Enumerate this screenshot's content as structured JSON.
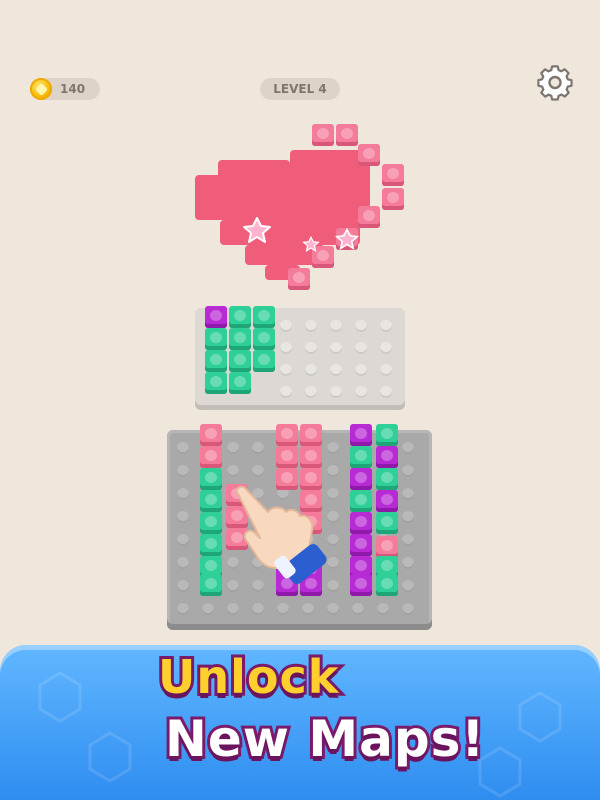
{
  "hud": {
    "coins": "140",
    "level": "LEVEL 4",
    "coin_icon": "coin-icon",
    "settings_icon": "gear-icon"
  },
  "banner": {
    "line1": "Unlock",
    "line2": "New Maps!"
  },
  "colors": {
    "background": "#efe6dc",
    "pink": "#f25e7e",
    "green": "#2fcf98",
    "magenta": "#b82ad4",
    "banner_blue": "#3d98f5",
    "title_yellow": "#ffcf2e"
  }
}
